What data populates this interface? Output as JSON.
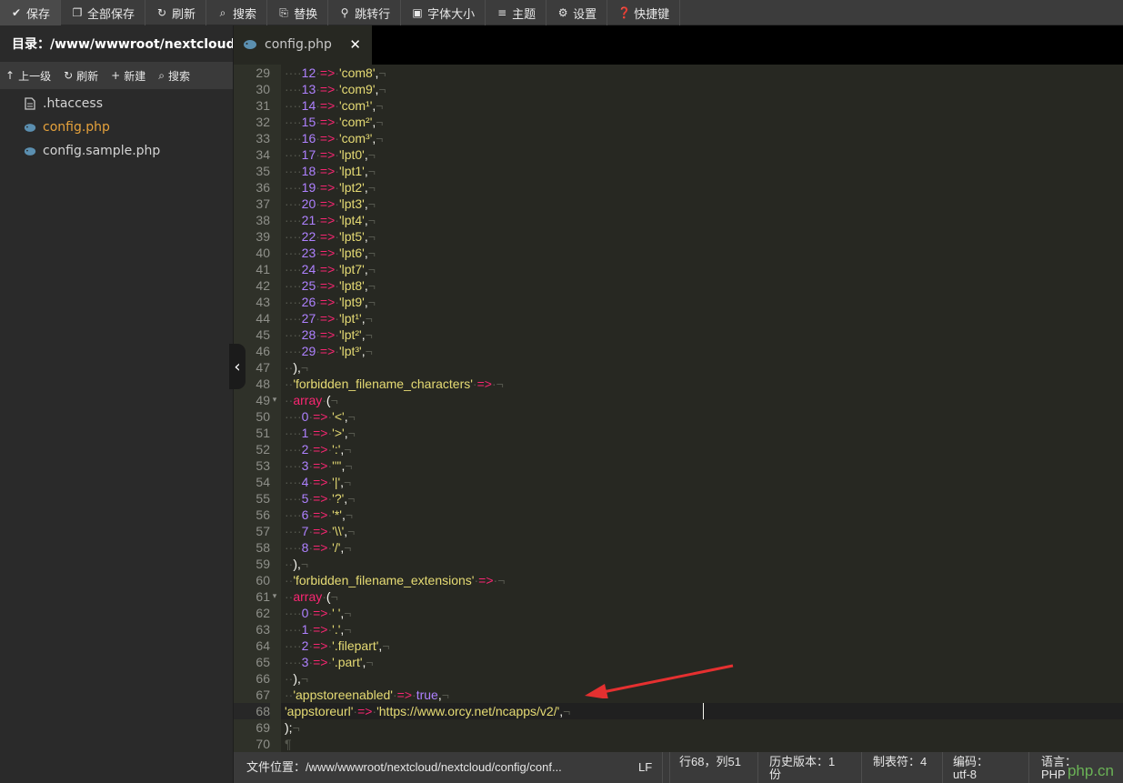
{
  "toolbar": {
    "buttons": [
      {
        "label": "保存",
        "icon": "check-icon"
      },
      {
        "label": "全部保存",
        "icon": "copy-icon"
      },
      {
        "label": "刷新",
        "icon": "refresh-icon"
      },
      {
        "label": "搜索",
        "icon": "search-icon"
      },
      {
        "label": "替换",
        "icon": "replace-icon"
      },
      {
        "label": "跳转行",
        "icon": "goto-line-icon"
      },
      {
        "label": "字体大小",
        "icon": "font-size-icon"
      },
      {
        "label": "主题",
        "icon": "theme-icon"
      },
      {
        "label": "设置",
        "icon": "gear-icon"
      },
      {
        "label": "快捷键",
        "icon": "help-icon"
      }
    ]
  },
  "sidebar": {
    "dir_label": "目录：/www/wwwroot/nextcloud...",
    "actions": [
      {
        "label": "上一级",
        "icon": "arrow-up-icon"
      },
      {
        "label": "刷新",
        "icon": "refresh-icon"
      },
      {
        "label": "新建",
        "icon": "plus-icon"
      },
      {
        "label": "搜索",
        "icon": "search-icon"
      }
    ],
    "files": [
      {
        "name": ".htaccess",
        "icon": "file-icon",
        "active": false
      },
      {
        "name": "config.php",
        "icon": "php-elephant-icon",
        "active": true
      },
      {
        "name": "config.sample.php",
        "icon": "php-elephant-icon",
        "active": false
      }
    ]
  },
  "tab": {
    "label": "config.php",
    "close": "✕"
  },
  "editor": {
    "first_line": 29,
    "current_line": 68,
    "lines": [
      [
        [
          "ws",
          "····"
        ],
        [
          "num",
          "12"
        ],
        [
          "ws",
          "·"
        ],
        [
          "op",
          "=>"
        ],
        [
          "ws",
          "·"
        ],
        [
          "str",
          "'com8'"
        ],
        [
          "pn",
          ","
        ],
        [
          "eol",
          "¬"
        ]
      ],
      [
        [
          "ws",
          "····"
        ],
        [
          "num",
          "13"
        ],
        [
          "ws",
          "·"
        ],
        [
          "op",
          "=>"
        ],
        [
          "ws",
          "·"
        ],
        [
          "str",
          "'com9'"
        ],
        [
          "pn",
          ","
        ],
        [
          "eol",
          "¬"
        ]
      ],
      [
        [
          "ws",
          "····"
        ],
        [
          "num",
          "14"
        ],
        [
          "ws",
          "·"
        ],
        [
          "op",
          "=>"
        ],
        [
          "ws",
          "·"
        ],
        [
          "str",
          "'com¹'"
        ],
        [
          "pn",
          ","
        ],
        [
          "eol",
          "¬"
        ]
      ],
      [
        [
          "ws",
          "····"
        ],
        [
          "num",
          "15"
        ],
        [
          "ws",
          "·"
        ],
        [
          "op",
          "=>"
        ],
        [
          "ws",
          "·"
        ],
        [
          "str",
          "'com²'"
        ],
        [
          "pn",
          ","
        ],
        [
          "eol",
          "¬"
        ]
      ],
      [
        [
          "ws",
          "····"
        ],
        [
          "num",
          "16"
        ],
        [
          "ws",
          "·"
        ],
        [
          "op",
          "=>"
        ],
        [
          "ws",
          "·"
        ],
        [
          "str",
          "'com³'"
        ],
        [
          "pn",
          ","
        ],
        [
          "eol",
          "¬"
        ]
      ],
      [
        [
          "ws",
          "····"
        ],
        [
          "num",
          "17"
        ],
        [
          "ws",
          "·"
        ],
        [
          "op",
          "=>"
        ],
        [
          "ws",
          "·"
        ],
        [
          "str",
          "'lpt0'"
        ],
        [
          "pn",
          ","
        ],
        [
          "eol",
          "¬"
        ]
      ],
      [
        [
          "ws",
          "····"
        ],
        [
          "num",
          "18"
        ],
        [
          "ws",
          "·"
        ],
        [
          "op",
          "=>"
        ],
        [
          "ws",
          "·"
        ],
        [
          "str",
          "'lpt1'"
        ],
        [
          "pn",
          ","
        ],
        [
          "eol",
          "¬"
        ]
      ],
      [
        [
          "ws",
          "····"
        ],
        [
          "num",
          "19"
        ],
        [
          "ws",
          "·"
        ],
        [
          "op",
          "=>"
        ],
        [
          "ws",
          "·"
        ],
        [
          "str",
          "'lpt2'"
        ],
        [
          "pn",
          ","
        ],
        [
          "eol",
          "¬"
        ]
      ],
      [
        [
          "ws",
          "····"
        ],
        [
          "num",
          "20"
        ],
        [
          "ws",
          "·"
        ],
        [
          "op",
          "=>"
        ],
        [
          "ws",
          "·"
        ],
        [
          "str",
          "'lpt3'"
        ],
        [
          "pn",
          ","
        ],
        [
          "eol",
          "¬"
        ]
      ],
      [
        [
          "ws",
          "····"
        ],
        [
          "num",
          "21"
        ],
        [
          "ws",
          "·"
        ],
        [
          "op",
          "=>"
        ],
        [
          "ws",
          "·"
        ],
        [
          "str",
          "'lpt4'"
        ],
        [
          "pn",
          ","
        ],
        [
          "eol",
          "¬"
        ]
      ],
      [
        [
          "ws",
          "····"
        ],
        [
          "num",
          "22"
        ],
        [
          "ws",
          "·"
        ],
        [
          "op",
          "=>"
        ],
        [
          "ws",
          "·"
        ],
        [
          "str",
          "'lpt5'"
        ],
        [
          "pn",
          ","
        ],
        [
          "eol",
          "¬"
        ]
      ],
      [
        [
          "ws",
          "····"
        ],
        [
          "num",
          "23"
        ],
        [
          "ws",
          "·"
        ],
        [
          "op",
          "=>"
        ],
        [
          "ws",
          "·"
        ],
        [
          "str",
          "'lpt6'"
        ],
        [
          "pn",
          ","
        ],
        [
          "eol",
          "¬"
        ]
      ],
      [
        [
          "ws",
          "····"
        ],
        [
          "num",
          "24"
        ],
        [
          "ws",
          "·"
        ],
        [
          "op",
          "=>"
        ],
        [
          "ws",
          "·"
        ],
        [
          "str",
          "'lpt7'"
        ],
        [
          "pn",
          ","
        ],
        [
          "eol",
          "¬"
        ]
      ],
      [
        [
          "ws",
          "····"
        ],
        [
          "num",
          "25"
        ],
        [
          "ws",
          "·"
        ],
        [
          "op",
          "=>"
        ],
        [
          "ws",
          "·"
        ],
        [
          "str",
          "'lpt8'"
        ],
        [
          "pn",
          ","
        ],
        [
          "eol",
          "¬"
        ]
      ],
      [
        [
          "ws",
          "····"
        ],
        [
          "num",
          "26"
        ],
        [
          "ws",
          "·"
        ],
        [
          "op",
          "=>"
        ],
        [
          "ws",
          "·"
        ],
        [
          "str",
          "'lpt9'"
        ],
        [
          "pn",
          ","
        ],
        [
          "eol",
          "¬"
        ]
      ],
      [
        [
          "ws",
          "····"
        ],
        [
          "num",
          "27"
        ],
        [
          "ws",
          "·"
        ],
        [
          "op",
          "=>"
        ],
        [
          "ws",
          "·"
        ],
        [
          "str",
          "'lpt¹'"
        ],
        [
          "pn",
          ","
        ],
        [
          "eol",
          "¬"
        ]
      ],
      [
        [
          "ws",
          "····"
        ],
        [
          "num",
          "28"
        ],
        [
          "ws",
          "·"
        ],
        [
          "op",
          "=>"
        ],
        [
          "ws",
          "·"
        ],
        [
          "str",
          "'lpt²'"
        ],
        [
          "pn",
          ","
        ],
        [
          "eol",
          "¬"
        ]
      ],
      [
        [
          "ws",
          "····"
        ],
        [
          "num",
          "29"
        ],
        [
          "ws",
          "·"
        ],
        [
          "op",
          "=>"
        ],
        [
          "ws",
          "·"
        ],
        [
          "str",
          "'lpt³'"
        ],
        [
          "pn",
          ","
        ],
        [
          "eol",
          "¬"
        ]
      ],
      [
        [
          "ws",
          "··"
        ],
        [
          "pn",
          "),"
        ],
        [
          "eol",
          "¬"
        ]
      ],
      [
        [
          "ws",
          "··"
        ],
        [
          "str",
          "'forbidden_filename_characters'"
        ],
        [
          "ws",
          "·"
        ],
        [
          "op",
          "=>"
        ],
        [
          "ws",
          "·"
        ],
        [
          "eol",
          "¬"
        ]
      ],
      [
        [
          "ws",
          "··"
        ],
        [
          "kw",
          "array"
        ],
        [
          "ws",
          "·"
        ],
        [
          "pn",
          "("
        ],
        [
          "eol",
          "¬"
        ]
      ],
      [
        [
          "ws",
          "····"
        ],
        [
          "num",
          "0"
        ],
        [
          "ws",
          "·"
        ],
        [
          "op",
          "=>"
        ],
        [
          "ws",
          "·"
        ],
        [
          "str",
          "'<'"
        ],
        [
          "pn",
          ","
        ],
        [
          "eol",
          "¬"
        ]
      ],
      [
        [
          "ws",
          "····"
        ],
        [
          "num",
          "1"
        ],
        [
          "ws",
          "·"
        ],
        [
          "op",
          "=>"
        ],
        [
          "ws",
          "·"
        ],
        [
          "str",
          "'>'"
        ],
        [
          "pn",
          ","
        ],
        [
          "eol",
          "¬"
        ]
      ],
      [
        [
          "ws",
          "····"
        ],
        [
          "num",
          "2"
        ],
        [
          "ws",
          "·"
        ],
        [
          "op",
          "=>"
        ],
        [
          "ws",
          "·"
        ],
        [
          "str",
          "':'"
        ],
        [
          "pn",
          ","
        ],
        [
          "eol",
          "¬"
        ]
      ],
      [
        [
          "ws",
          "····"
        ],
        [
          "num",
          "3"
        ],
        [
          "ws",
          "·"
        ],
        [
          "op",
          "=>"
        ],
        [
          "ws",
          "·"
        ],
        [
          "str",
          "'\"'"
        ],
        [
          "pn",
          ","
        ],
        [
          "eol",
          "¬"
        ]
      ],
      [
        [
          "ws",
          "····"
        ],
        [
          "num",
          "4"
        ],
        [
          "ws",
          "·"
        ],
        [
          "op",
          "=>"
        ],
        [
          "ws",
          "·"
        ],
        [
          "str",
          "'|'"
        ],
        [
          "pn",
          ","
        ],
        [
          "eol",
          "¬"
        ]
      ],
      [
        [
          "ws",
          "····"
        ],
        [
          "num",
          "5"
        ],
        [
          "ws",
          "·"
        ],
        [
          "op",
          "=>"
        ],
        [
          "ws",
          "·"
        ],
        [
          "str",
          "'?'"
        ],
        [
          "pn",
          ","
        ],
        [
          "eol",
          "¬"
        ]
      ],
      [
        [
          "ws",
          "····"
        ],
        [
          "num",
          "6"
        ],
        [
          "ws",
          "·"
        ],
        [
          "op",
          "=>"
        ],
        [
          "ws",
          "·"
        ],
        [
          "str",
          "'*'"
        ],
        [
          "pn",
          ","
        ],
        [
          "eol",
          "¬"
        ]
      ],
      [
        [
          "ws",
          "····"
        ],
        [
          "num",
          "7"
        ],
        [
          "ws",
          "·"
        ],
        [
          "op",
          "=>"
        ],
        [
          "ws",
          "·"
        ],
        [
          "str",
          "'\\\\'"
        ],
        [
          "pn",
          ","
        ],
        [
          "eol",
          "¬"
        ]
      ],
      [
        [
          "ws",
          "····"
        ],
        [
          "num",
          "8"
        ],
        [
          "ws",
          "·"
        ],
        [
          "op",
          "=>"
        ],
        [
          "ws",
          "·"
        ],
        [
          "str",
          "'/'"
        ],
        [
          "pn",
          ","
        ],
        [
          "eol",
          "¬"
        ]
      ],
      [
        [
          "ws",
          "··"
        ],
        [
          "pn",
          "),"
        ],
        [
          "eol",
          "¬"
        ]
      ],
      [
        [
          "ws",
          "··"
        ],
        [
          "str",
          "'forbidden_filename_extensions'"
        ],
        [
          "ws",
          "·"
        ],
        [
          "op",
          "=>"
        ],
        [
          "ws",
          "·"
        ],
        [
          "eol",
          "¬"
        ]
      ],
      [
        [
          "ws",
          "··"
        ],
        [
          "kw",
          "array"
        ],
        [
          "ws",
          "·"
        ],
        [
          "pn",
          "("
        ],
        [
          "eol",
          "¬"
        ]
      ],
      [
        [
          "ws",
          "····"
        ],
        [
          "num",
          "0"
        ],
        [
          "ws",
          "·"
        ],
        [
          "op",
          "=>"
        ],
        [
          "ws",
          "·"
        ],
        [
          "str",
          "' '"
        ],
        [
          "pn",
          ","
        ],
        [
          "eol",
          "¬"
        ]
      ],
      [
        [
          "ws",
          "····"
        ],
        [
          "num",
          "1"
        ],
        [
          "ws",
          "·"
        ],
        [
          "op",
          "=>"
        ],
        [
          "ws",
          "·"
        ],
        [
          "str",
          "'.'"
        ],
        [
          "pn",
          ","
        ],
        [
          "eol",
          "¬"
        ]
      ],
      [
        [
          "ws",
          "····"
        ],
        [
          "num",
          "2"
        ],
        [
          "ws",
          "·"
        ],
        [
          "op",
          "=>"
        ],
        [
          "ws",
          "·"
        ],
        [
          "str",
          "'.filepart'"
        ],
        [
          "pn",
          ","
        ],
        [
          "eol",
          "¬"
        ]
      ],
      [
        [
          "ws",
          "····"
        ],
        [
          "num",
          "3"
        ],
        [
          "ws",
          "·"
        ],
        [
          "op",
          "=>"
        ],
        [
          "ws",
          "·"
        ],
        [
          "str",
          "'.part'"
        ],
        [
          "pn",
          ","
        ],
        [
          "eol",
          "¬"
        ]
      ],
      [
        [
          "ws",
          "··"
        ],
        [
          "pn",
          "),"
        ],
        [
          "eol",
          "¬"
        ]
      ],
      [
        [
          "ws",
          "··"
        ],
        [
          "str",
          "'appstoreenabled'"
        ],
        [
          "ws",
          "·"
        ],
        [
          "op",
          "=>"
        ],
        [
          "ws",
          "·"
        ],
        [
          "bool",
          "true"
        ],
        [
          "pn",
          ","
        ],
        [
          "eol",
          "¬"
        ]
      ],
      [
        [
          "str",
          "'appstoreurl'"
        ],
        [
          "ws",
          "·"
        ],
        [
          "op",
          "=>"
        ],
        [
          "ws",
          "·"
        ],
        [
          "str",
          "'https://www.orcy.net/ncapps/v2/'"
        ],
        [
          "pn",
          ","
        ],
        [
          "eol",
          "¬"
        ]
      ],
      [
        [
          "pn",
          ");"
        ],
        [
          "eol",
          "¬"
        ]
      ],
      [
        [
          "eol",
          "¶"
        ]
      ]
    ],
    "fold_lines": [
      49,
      61
    ]
  },
  "statusbar": {
    "file_path": "文件位置：/www/wwwroot/nextcloud/nextcloud/config/conf...",
    "line_ending": "LF",
    "row_col": "行68，列51",
    "history": "历史版本：1份",
    "tab_size": "制表符：4",
    "encoding": "编码：utf-8",
    "language": "语言：PHP"
  },
  "watermark": "php.cn",
  "colors": {
    "bg": "#272822",
    "string": "#e6db74",
    "number": "#ae81ff",
    "operator": "#f92672",
    "active_file": "#e6a23c",
    "arrow": "#e53030"
  }
}
